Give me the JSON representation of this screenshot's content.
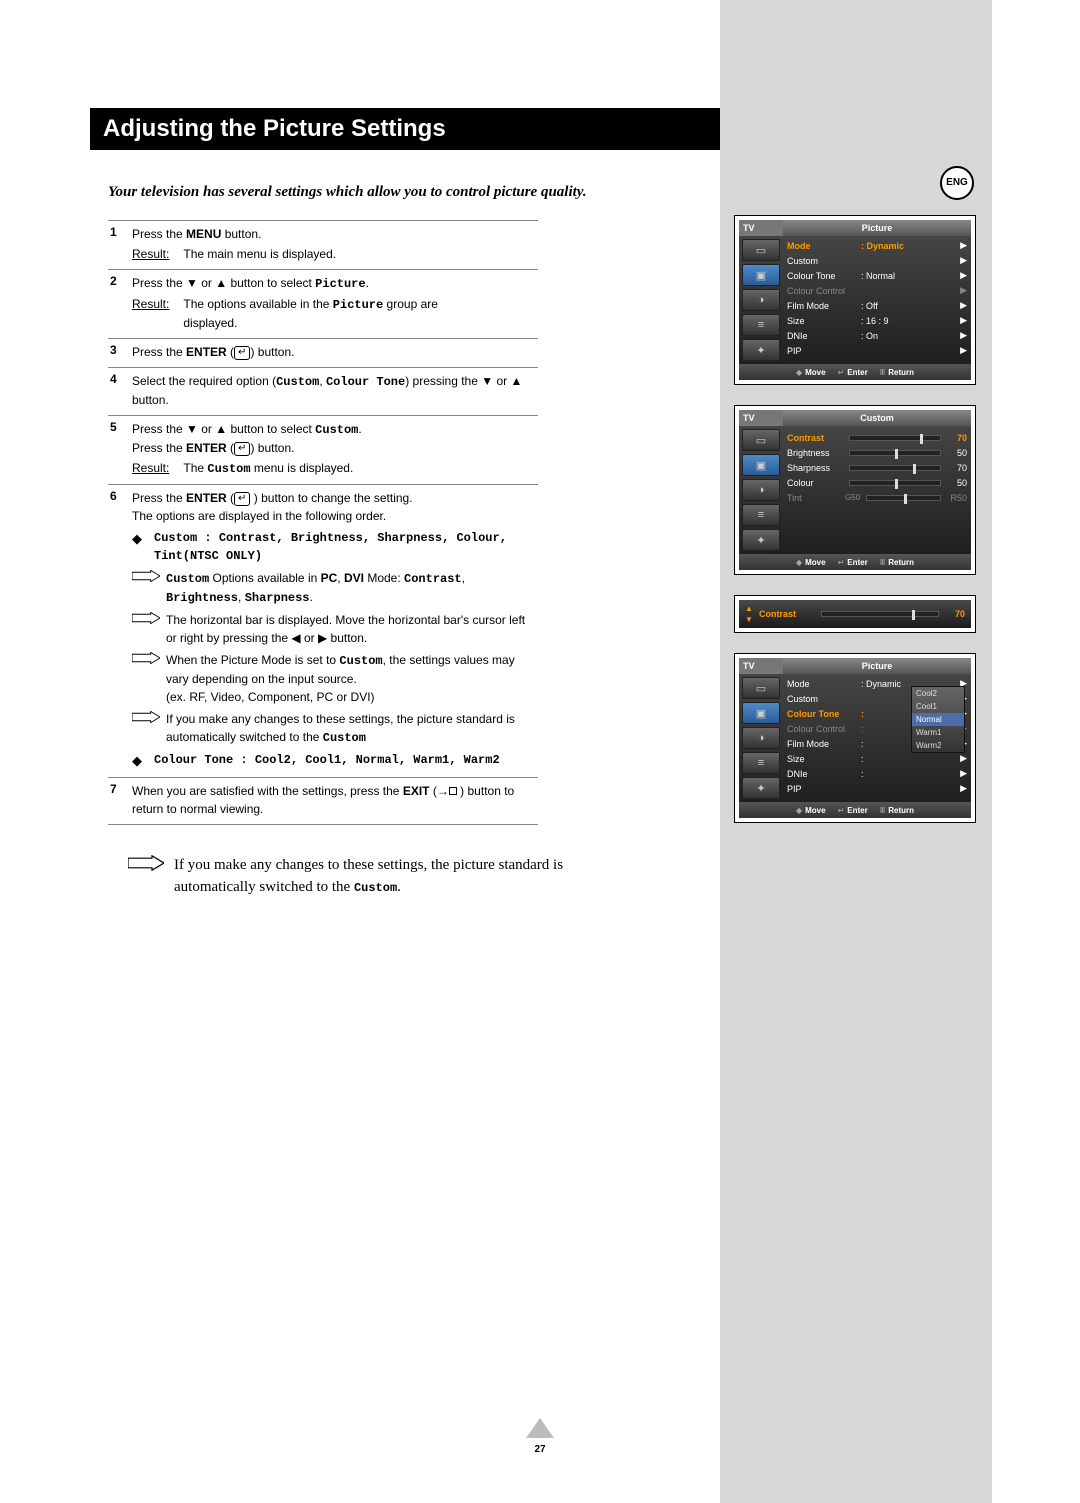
{
  "lang_badge": "ENG",
  "title": "Adjusting the Picture Settings",
  "intro": "Your television has several settings which allow you to control picture quality.",
  "result_label": "Result:",
  "steps": {
    "s1": {
      "num": "1",
      "text_a": "Press the ",
      "bold": "MENU",
      "text_b": " button.",
      "result": "The main menu is displayed."
    },
    "s2": {
      "num": "2",
      "text_a": "Press the ▼ or ▲ button to select ",
      "mono": "Picture",
      "text_b": ".",
      "result_a": "The options available in the ",
      "result_mono": "Picture",
      "result_b": " group are displayed."
    },
    "s3": {
      "num": "3",
      "text_a": "Press the ",
      "bold": "ENTER",
      "text_b": " button."
    },
    "s4": {
      "num": "4",
      "text_a": "Select the required option (",
      "mono1": "Custom",
      "text_b": ", ",
      "mono2": "Colour Tone",
      "text_c": ") pressing the ▼ or ▲ button."
    },
    "s5": {
      "num": "5",
      "line1_a": "Press the ▼ or ▲ button to select ",
      "line1_mono": "Custom",
      "line1_b": ".",
      "line2_a": "Press the ",
      "line2_bold": "ENTER",
      "line2_b": " button.",
      "result_a": "The ",
      "result_mono": "Custom",
      "result_b": " menu is displayed."
    },
    "s6": {
      "num": "6",
      "line1_a": "Press the ",
      "line1_bold": "ENTER",
      "line1_b": " button to change the setting.",
      "line2": "The options are displayed in the following order.",
      "b1_a": "Custom : ",
      "b1_b": "Contrast",
      "b1_c": ", ",
      "b1_d": "Brightness",
      "b1_e": ", ",
      "b1_f": "Sharpness",
      "b1_g": ", ",
      "b1_h": "Colour",
      "b1_i": ", ",
      "b1_j": "Tint(NTSC ONLY)",
      "p1_a": "Custom",
      "p1_b": " Options available in ",
      "p1_c": "PC",
      "p1_d": ", ",
      "p1_e": "DVI",
      "p1_f": " Mode: ",
      "p1_g": "Contrast",
      "p1_h": ", ",
      "p1_i": "Brightness",
      "p1_j": ", ",
      "p1_k": "Sharpness",
      "p1_l": ".",
      "p2": "The horizontal bar is displayed. Move the horizontal bar's cursor left or right by pressing the ◀ or ▶ button.",
      "p3_a": "When the Picture Mode is set to ",
      "p3_mono": "Custom",
      "p3_b": ", the settings values may vary depending on the input source.",
      "p3_c": "(ex. RF, Video, Component, PC or DVI)",
      "p4_a": "If you make any changes to these settings, the picture standard is automatically switched to the ",
      "p4_mono": "Custom",
      "b2": "Colour Tone : Cool2, Cool1, Normal, Warm1, Warm2"
    },
    "s7": {
      "num": "7",
      "text_a": "When you are satisfied with the settings, press the ",
      "bold": "EXIT",
      "text_b": " button to return to normal viewing."
    }
  },
  "footer_note_a": "If you make any changes to these settings, the picture standard is automatically switched to the ",
  "footer_note_mono": "Custom",
  "footer_note_b": ".",
  "page_number": "27",
  "osd": {
    "tv": "TV",
    "footer": {
      "move": "Move",
      "enter": "Enter",
      "ret": "Return"
    },
    "picture1": {
      "title": "Picture",
      "rows": [
        {
          "label": "Mode",
          "val": ": Dynamic",
          "sel": true
        },
        {
          "label": "Custom",
          "val": ""
        },
        {
          "label": "Colour Tone",
          "val": ": Normal"
        },
        {
          "label": "Colour Control",
          "val": "",
          "dim": true
        },
        {
          "label": "Film Mode",
          "val": ": Off"
        },
        {
          "label": "Size",
          "val": ": 16 : 9"
        },
        {
          "label": "DNIe",
          "val": ": On"
        },
        {
          "label": "PIP",
          "val": ""
        }
      ]
    },
    "custom": {
      "title": "Custom",
      "sliders": [
        {
          "label": "Contrast",
          "num": "70",
          "pos": 78,
          "sel": true
        },
        {
          "label": "Brightness",
          "num": "50",
          "pos": 50
        },
        {
          "label": "Sharpness",
          "num": "70",
          "pos": 70
        },
        {
          "label": "Colour",
          "num": "50",
          "pos": 50
        },
        {
          "label": "Tint",
          "left": "G50",
          "right": "R50",
          "pos": 50,
          "dim": true
        }
      ]
    },
    "mini": {
      "label": "Contrast",
      "num": "70",
      "pos": 78
    },
    "picture2": {
      "title": "Picture",
      "rows": [
        {
          "label": "Mode",
          "val": ": Dynamic"
        },
        {
          "label": "Custom",
          "val": ""
        },
        {
          "label": "Colour Tone",
          "val": ":",
          "sel": true
        },
        {
          "label": "Colour Control",
          "val": ":",
          "dim": true
        },
        {
          "label": "Film Mode",
          "val": ":"
        },
        {
          "label": "Size",
          "val": ":"
        },
        {
          "label": "DNIe",
          "val": ":"
        },
        {
          "label": "PIP",
          "val": ""
        }
      ],
      "dropdown": [
        "Cool2",
        "Cool1",
        "Normal",
        "Warm1",
        "Warm2"
      ],
      "dropdown_sel": "Normal"
    }
  }
}
